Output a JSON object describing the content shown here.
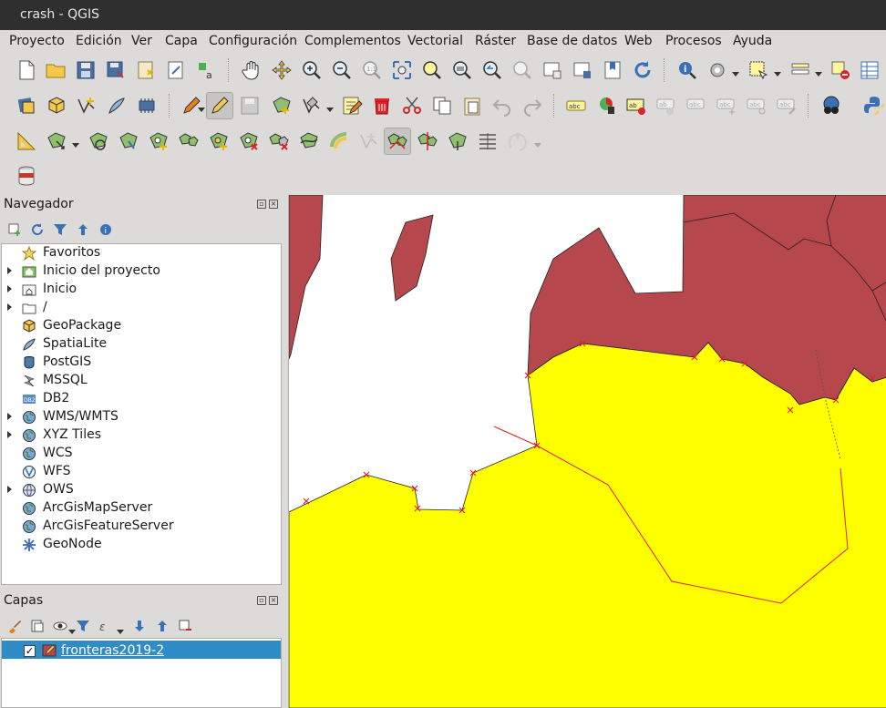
{
  "window": {
    "title": "crash - QGIS"
  },
  "menu": [
    "Proyecto",
    "Edición",
    "Ver",
    "Capa",
    "Configuración",
    "Complementos",
    "Vectorial",
    "Ráster",
    "Base de datos",
    "Web",
    "Procesos",
    "Ayuda"
  ],
  "browser": {
    "title": "Navegador",
    "items": [
      {
        "label": "Favoritos",
        "icon": "star-icon",
        "expandable": false
      },
      {
        "label": "Inicio del proyecto",
        "icon": "project-home-icon",
        "expandable": true
      },
      {
        "label": "Inicio",
        "icon": "home-folder-icon",
        "expandable": true
      },
      {
        "label": "/",
        "icon": "folder-icon",
        "expandable": true
      },
      {
        "label": "GeoPackage",
        "icon": "geopackage-icon",
        "expandable": false
      },
      {
        "label": "SpatiaLite",
        "icon": "spatialite-icon",
        "expandable": false
      },
      {
        "label": "PostGIS",
        "icon": "postgis-icon",
        "expandable": false
      },
      {
        "label": "MSSQL",
        "icon": "mssql-icon",
        "expandable": false
      },
      {
        "label": "DB2",
        "icon": "db2-icon",
        "expandable": false
      },
      {
        "label": "WMS/WMTS",
        "icon": "globe-icon",
        "expandable": true
      },
      {
        "label": "XYZ Tiles",
        "icon": "globe-icon",
        "expandable": true
      },
      {
        "label": "WCS",
        "icon": "globe-icon",
        "expandable": false
      },
      {
        "label": "WFS",
        "icon": "wfs-icon",
        "expandable": false
      },
      {
        "label": "OWS",
        "icon": "globe-icon",
        "expandable": true
      },
      {
        "label": "ArcGisMapServer",
        "icon": "globe-icon",
        "expandable": false
      },
      {
        "label": "ArcGisFeatureServer",
        "icon": "globe-icon",
        "expandable": false
      },
      {
        "label": "GeoNode",
        "icon": "geonode-icon",
        "expandable": false
      }
    ]
  },
  "layers_panel": {
    "title": "Capas",
    "layers": [
      {
        "label": "fronteras2019-2",
        "checked": true,
        "selected": true
      }
    ]
  },
  "map": {
    "colors": {
      "background": "#ffffff",
      "polygon_dark": "#b5474d",
      "polygon_yellow": "#ffff00",
      "edit_line": "#e0202a",
      "selection": "#308cc6"
    }
  }
}
